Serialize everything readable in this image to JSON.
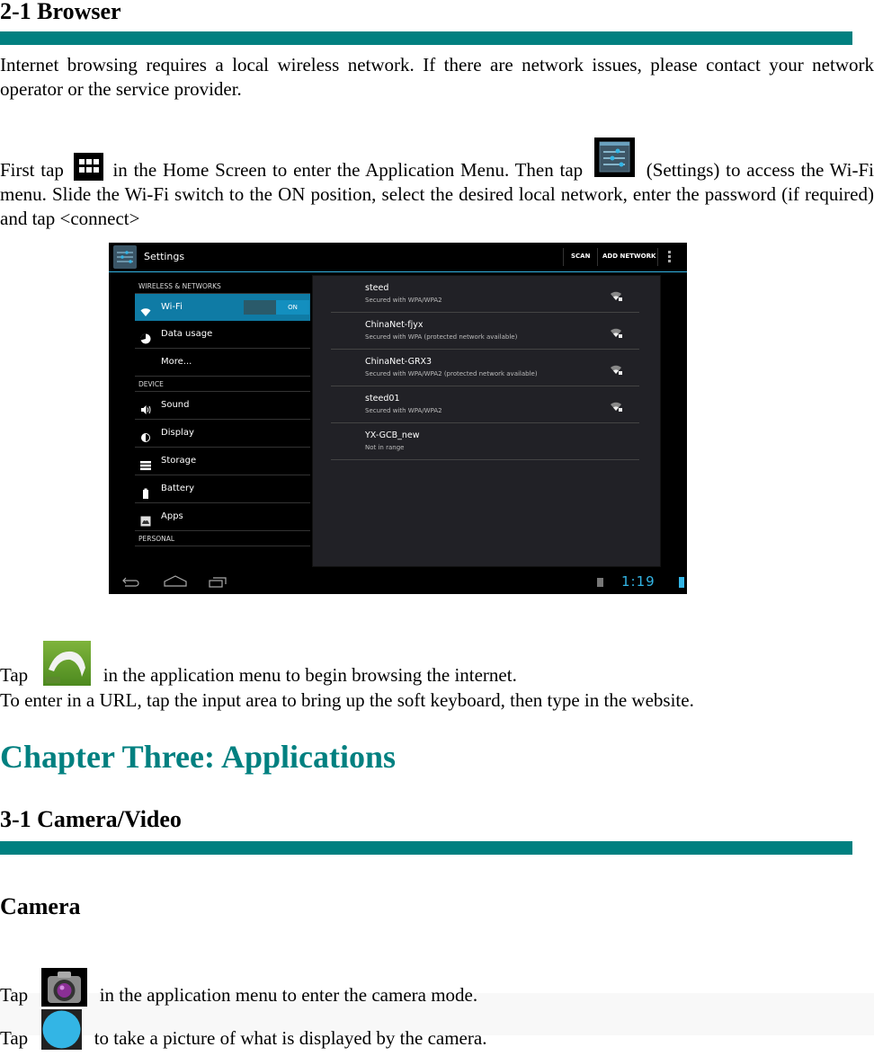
{
  "section_browser": {
    "heading": "2-1 Browser",
    "intro": "Internet browsing requires a local wireless network. If there are network issues, please contact your network operator or the service provider.",
    "instructions": {
      "part1": "First tap",
      "part2": "in the Home Screen to enter the Application Menu.   Then tap",
      "part3": "(Settings) to access the Wi-Fi menu.  Slide the Wi-Fi switch to the ON position, select the desired local network, enter the password (if required) and tap <connect>"
    },
    "icons": {
      "app_menu": "app-grid-icon",
      "settings": "settings-sliders-icon",
      "browser": "dolphin-browser-icon"
    },
    "tap_browser": {
      "prefix": "Tap",
      "suffix": "in the application menu to begin browsing the internet."
    },
    "url_text": "To enter in a URL, tap the input area to bring up the soft keyboard, then type in the website."
  },
  "screenshot": {
    "action_bar": {
      "title": "Settings",
      "actions": [
        "SCAN",
        "ADD NETWORK"
      ]
    },
    "sidebar": {
      "sections": [
        {
          "header": "WIRELESS & NETWORKS"
        },
        {
          "header": "DEVICE"
        },
        {
          "header": "PERSONAL"
        }
      ],
      "items": [
        {
          "label": "Wi-Fi",
          "icon": "wifi-icon",
          "toggle": "ON"
        },
        {
          "label": "Data usage",
          "icon": "data-usage-icon"
        },
        {
          "label": "More...",
          "icon": ""
        },
        {
          "label": "Sound",
          "icon": "speaker-icon"
        },
        {
          "label": "Display",
          "icon": "display-icon"
        },
        {
          "label": "Storage",
          "icon": "storage-icon"
        },
        {
          "label": "Battery",
          "icon": "battery-icon"
        },
        {
          "label": "Apps",
          "icon": "apps-icon"
        }
      ]
    },
    "networks": [
      {
        "name": "steed",
        "status": "Secured with WPA/WPA2",
        "signal": true
      },
      {
        "name": "ChinaNet-fjyx",
        "status": "Secured with WPA (protected network available)",
        "signal": true
      },
      {
        "name": "ChinaNet-GRX3",
        "status": "Secured with WPA/WPA2 (protected network available)",
        "signal": true
      },
      {
        "name": "steed01",
        "status": "Secured with WPA/WPA2",
        "signal": true
      },
      {
        "name": "YX-GCB_new",
        "status": "Not in range",
        "signal": false
      }
    ],
    "status_bar": {
      "time": "1:19"
    }
  },
  "chapter": {
    "title": "Chapter Three: Applications"
  },
  "section_camera": {
    "heading": "3-1 Camera/Video",
    "subheading": "Camera",
    "tap_camera": {
      "prefix": "Tap",
      "suffix": "in the application menu to enter the camera mode."
    },
    "tap_shutter": {
      "prefix": "Tap",
      "suffix": "to take a picture of what is displayed by the camera."
    }
  },
  "colors": {
    "accent_teal": "#008080",
    "holo_blue": "#33b5e5"
  }
}
